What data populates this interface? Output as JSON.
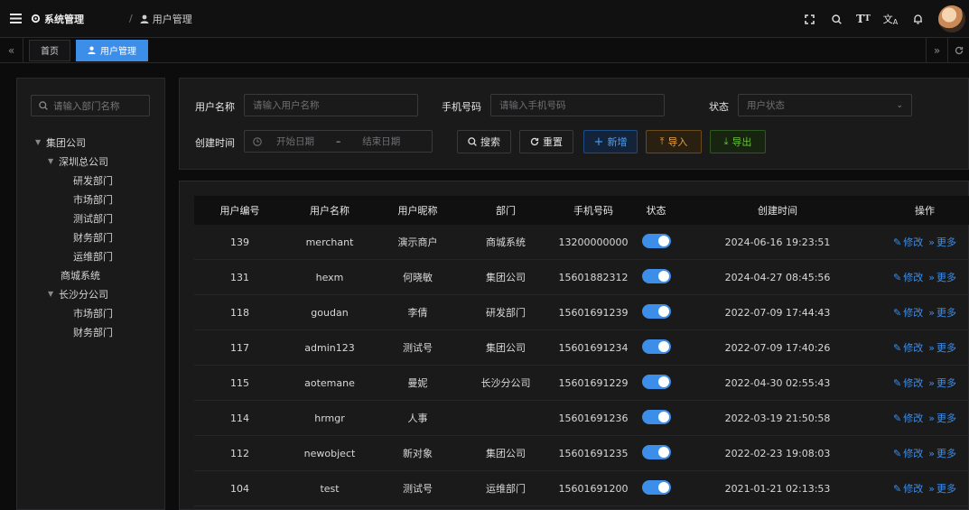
{
  "header": {
    "breadcrumb": [
      {
        "label": "系统管理",
        "icon": "gear-icon"
      },
      {
        "label": "用户管理",
        "icon": "user-icon"
      }
    ],
    "separator": "/",
    "icons": [
      "fullscreen-icon",
      "search-icon",
      "font-size-icon",
      "translate-icon",
      "bell-icon"
    ]
  },
  "tags": {
    "items": [
      {
        "label": "首页",
        "active": false
      },
      {
        "label": "用户管理",
        "active": true,
        "icon": "user-icon"
      }
    ]
  },
  "dept": {
    "search_placeholder": "请输入部门名称",
    "tree": [
      {
        "label": "集团公司",
        "level": 0,
        "expanded": true
      },
      {
        "label": "深圳总公司",
        "level": 1,
        "expanded": true
      },
      {
        "label": "研发部门",
        "level": 2
      },
      {
        "label": "市场部门",
        "level": 2
      },
      {
        "label": "测试部门",
        "level": 2
      },
      {
        "label": "财务部门",
        "level": 2
      },
      {
        "label": "运维部门",
        "level": 2
      },
      {
        "label": "商城系统",
        "level": 1
      },
      {
        "label": "长沙分公司",
        "level": 1,
        "expanded": true
      },
      {
        "label": "市场部门",
        "level": 2
      },
      {
        "label": "财务部门",
        "level": 2
      }
    ]
  },
  "form": {
    "username_label": "用户名称",
    "username_placeholder": "请输入用户名称",
    "phone_label": "手机号码",
    "phone_placeholder": "请输入手机号码",
    "status_label": "状态",
    "status_placeholder": "用户状态",
    "created_label": "创建时间",
    "start_placeholder": "开始日期",
    "range_sep": "–",
    "end_placeholder": "结束日期",
    "search_btn": "搜索",
    "reset_btn": "重置",
    "add_btn": "新增",
    "import_btn": "导入",
    "export_btn": "导出"
  },
  "table": {
    "columns": [
      "用户编号",
      "用户名称",
      "用户昵称",
      "部门",
      "手机号码",
      "状态",
      "创建时间",
      "操作"
    ],
    "edit_label": "修改",
    "more_label": "更多",
    "rows": [
      {
        "id": "139",
        "username": "merchant",
        "nickname": "演示商户",
        "dept": "商城系统",
        "phone": "13200000000",
        "status": true,
        "created": "2024-06-16 19:23:51"
      },
      {
        "id": "131",
        "username": "hexm",
        "nickname": "何晓敏",
        "dept": "集团公司",
        "phone": "15601882312",
        "status": true,
        "created": "2024-04-27 08:45:56"
      },
      {
        "id": "118",
        "username": "goudan",
        "nickname": "李倩",
        "dept": "研发部门",
        "phone": "15601691239",
        "status": true,
        "created": "2022-07-09 17:44:43"
      },
      {
        "id": "117",
        "username": "admin123",
        "nickname": "测试号",
        "dept": "集团公司",
        "phone": "15601691234",
        "status": true,
        "created": "2022-07-09 17:40:26"
      },
      {
        "id": "115",
        "username": "aotemane",
        "nickname": "曼妮",
        "dept": "长沙分公司",
        "phone": "15601691229",
        "status": true,
        "created": "2022-04-30 02:55:43"
      },
      {
        "id": "114",
        "username": "hrmgr",
        "nickname": "人事",
        "dept": "",
        "phone": "15601691236",
        "status": true,
        "created": "2022-03-19 21:50:58"
      },
      {
        "id": "112",
        "username": "newobject",
        "nickname": "新对象",
        "dept": "集团公司",
        "phone": "15601691235",
        "status": true,
        "created": "2022-02-23 19:08:03"
      },
      {
        "id": "104",
        "username": "test",
        "nickname": "测试号",
        "dept": "运维部门",
        "phone": "15601691200",
        "status": true,
        "created": "2021-01-21 02:13:53"
      }
    ]
  },
  "colors": {
    "accent": "#3d8ee8",
    "warning": "#e6a23c",
    "success": "#67c23a",
    "background": "#0c0c0d",
    "panel": "#1a1a1b"
  }
}
